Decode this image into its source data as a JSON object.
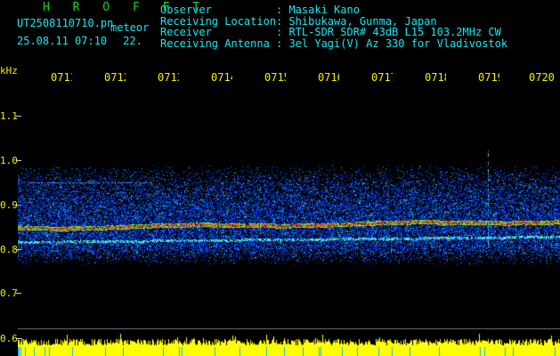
{
  "header": {
    "title": "H R O F F T",
    "filename": "UT2508110710.pn",
    "meteor_label": "meteor",
    "datetime": "25.08.11 07:10",
    "extra_value": "22."
  },
  "info": {
    "labels": [
      "Observer",
      "Receiving Location",
      "Receiver",
      "Receiving Antenna"
    ],
    "values": [
      ": Masaki Kano",
      ": Shibukawa, Gunma, Japan",
      ": RTL-SDR SDR# 43dB L15 103.2MHz CW",
      ": 3el Yagi(V) Az 330 for Vladivostok"
    ]
  },
  "axis": {
    "unit": "kHz",
    "y_ticks": [
      "1.1",
      "1.0",
      "0.9",
      "0.8",
      "0.7",
      "0.6"
    ],
    "x_ticks": [
      "0711",
      "0712",
      "0713",
      "0714",
      "0715",
      "0716",
      "0717",
      "0718",
      "0719",
      "0720"
    ]
  },
  "colors": {
    "text_cyan": "#16e8f0",
    "text_yellow": "#f2f200",
    "background": "#000000",
    "signal_red": "#ff2a00",
    "noise_blue": "#1f4bff",
    "amplitude_yellow": "#ffff00"
  }
}
